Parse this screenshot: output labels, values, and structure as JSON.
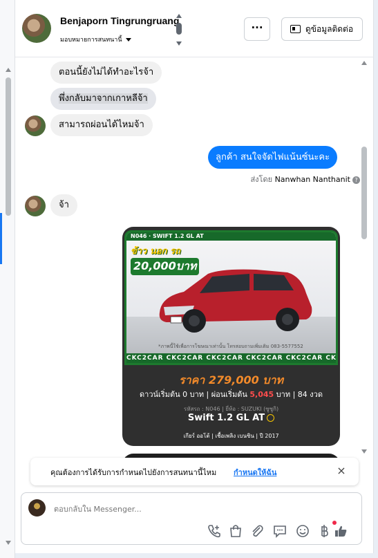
{
  "header": {
    "name": "Benjaporn Tingrungruang",
    "assign_label": "มอบหมายการสนทนานี้",
    "more_label": "···",
    "contact_label": "ดูข้อมูลติดต่อ"
  },
  "messages": {
    "m1": "ตอนนี้ยังไม่ได้ทำอะไรจ้า",
    "m2": "พึ่งกลับมาจากเกาหลีจ้า",
    "m3": "สามารถผ่อนได้ไหมจ้า",
    "out1": "ลูกค้า สนใจจัดไฟแน้นซ์นะคะ",
    "sent_by_label": "ส่งโดย",
    "sent_by_name": "Nanwhan Nanthanit",
    "m4": "จ้า"
  },
  "card": {
    "banner": "N046 · SWIFT 1.2 GL AT",
    "promo_line1": "ข้าว นอก รถ",
    "promo_line2": "20,000บาท",
    "strip_text": "CKC2CAR CKC2CAR CKC2CAR CKC2CAR CKC2CAR CKC2",
    "note": "*ภาพนี้ใช้เพื่อการโฆษณาเท่านั้น โทรสอบถามเพิ่มเติม 083-5577552",
    "price": "ราคา 279,000 บาท",
    "terms_prefix": "ดาวน์เริ่มต้น 0 บาท | ผ่อนเริ่มต้น",
    "terms_amount": "5,045",
    "terms_suffix": "บาท | 84 งวด",
    "meta": "รหัสรถ : N046 | ยี่ห้อ : SUZUKI (ซูซูกิ)",
    "model": "Swift 1.2 GL AT",
    "specs": "เกียร์ ออโต้  |  เชื้อเพลิง เบนซิน  |  ปี 2017"
  },
  "notice": {
    "text": "คุณต้องการได้รับการกำหนดไปยังการสนทนานี้ไหม",
    "link": "กำหนดให้ฉัน",
    "close": "×"
  },
  "composer": {
    "placeholder": "ตอบกลับใน Messenger..."
  },
  "icons": [
    "phone-add-icon",
    "shopping-bag-icon",
    "paperclip-icon",
    "chat-bubble-icon",
    "emoji-icon",
    "currency-icon",
    "thumbs-up-icon"
  ],
  "colors": {
    "accent": "#0a7cff",
    "link": "#1876f2",
    "price": "#f28a2a",
    "brand_green": "#1d7a2e"
  }
}
